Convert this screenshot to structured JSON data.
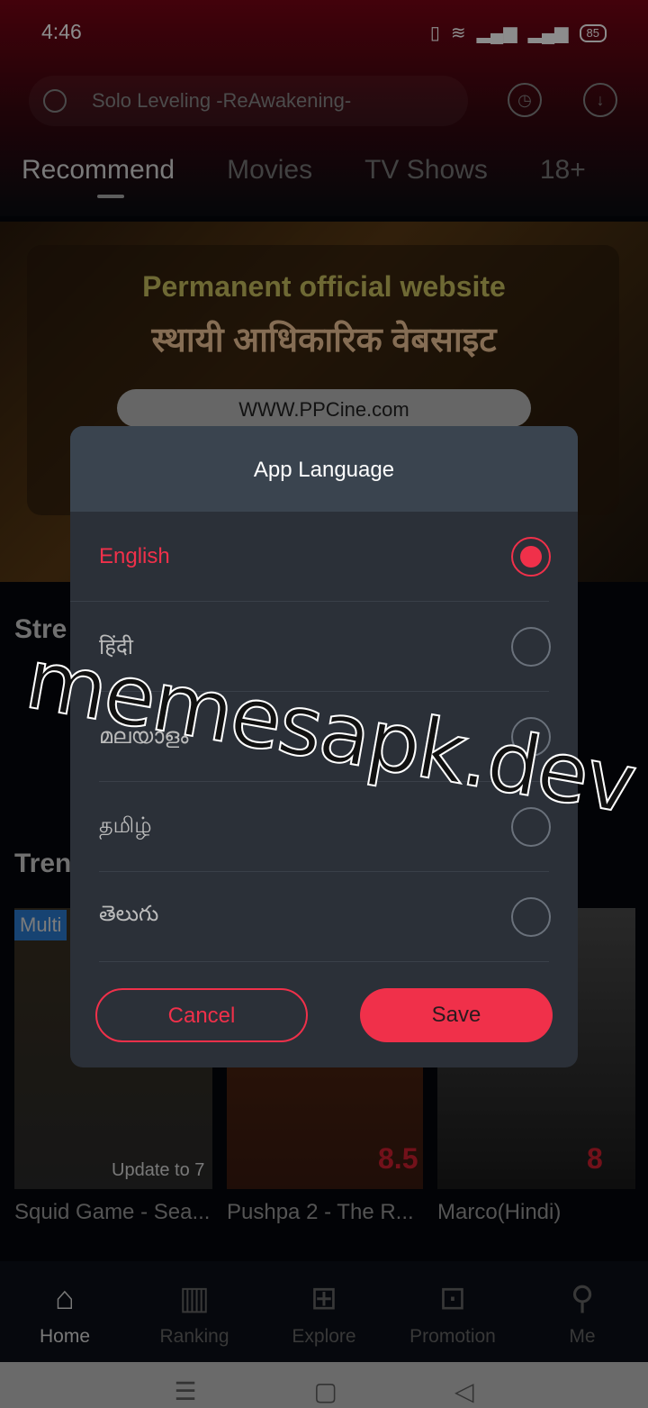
{
  "status": {
    "time": "4:46",
    "battery": "85"
  },
  "search": {
    "placeholder": "Solo Leveling -ReAwakening-"
  },
  "tabs": [
    "Recommend",
    "Movies",
    "TV Shows",
    "18+"
  ],
  "banner": {
    "line1": "Permanent official website",
    "line2": "स्थायी आधिकारिक वेबसाइट",
    "url": "WWW.PPCine.com"
  },
  "sections": {
    "streaming": "Stre",
    "trending": "Tren",
    "badge": "Multi"
  },
  "posters": [
    {
      "title": "Squid Game - Sea...",
      "note": "Update to 7"
    },
    {
      "title": "Pushpa 2 - The R...",
      "rating": "8.5"
    },
    {
      "title": "Marco(Hindi)",
      "rating": "8"
    }
  ],
  "nav": [
    {
      "label": "Home",
      "icon": "home-icon"
    },
    {
      "label": "Ranking",
      "icon": "ranking-icon"
    },
    {
      "label": "Explore",
      "icon": "grid-icon"
    },
    {
      "label": "Promotion",
      "icon": "gift-icon"
    },
    {
      "label": "Me",
      "icon": "user-icon"
    }
  ],
  "dialog": {
    "title": "App Language",
    "options": [
      "English",
      "हिंदी",
      "മലയാളം",
      "தமிழ்",
      "తెలుగు"
    ],
    "selected": 0,
    "cancel": "Cancel",
    "save": "Save"
  },
  "watermark": "memesapk.dev",
  "colors": {
    "accent": "#f0304a",
    "dialog_bg": "#2b3038",
    "dialog_header": "#3a444f"
  }
}
